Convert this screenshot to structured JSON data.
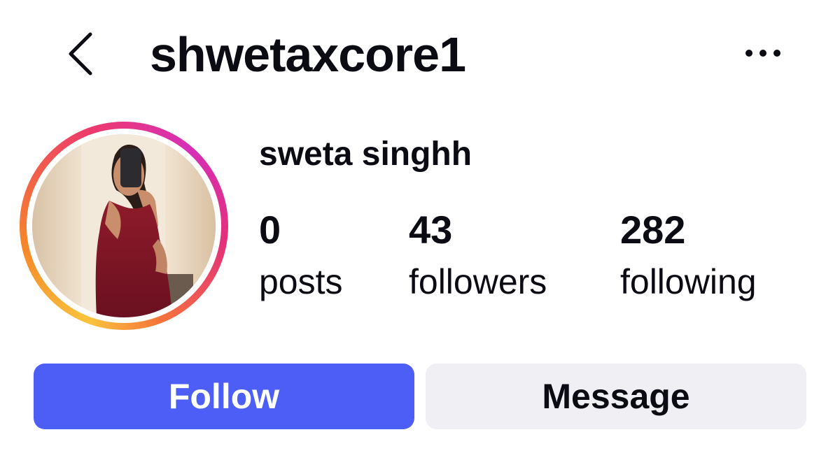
{
  "header": {
    "back_icon": "chevron-left-icon",
    "username": "shwetaxcore1",
    "more_icon": "more-horizontal-icon"
  },
  "profile": {
    "display_name": "sweta singhh",
    "avatar_story_ring_colors": [
      "#f9c43d",
      "#f58529",
      "#ee3a6b",
      "#d62fb8"
    ],
    "stats": [
      {
        "value": "0",
        "label": "posts"
      },
      {
        "value": "43",
        "label": "followers"
      },
      {
        "value": "282",
        "label": "following"
      }
    ]
  },
  "actions": {
    "follow_label": "Follow",
    "message_label": "Message",
    "follow_color": "#4c5ef5",
    "message_color": "#efeff4"
  }
}
